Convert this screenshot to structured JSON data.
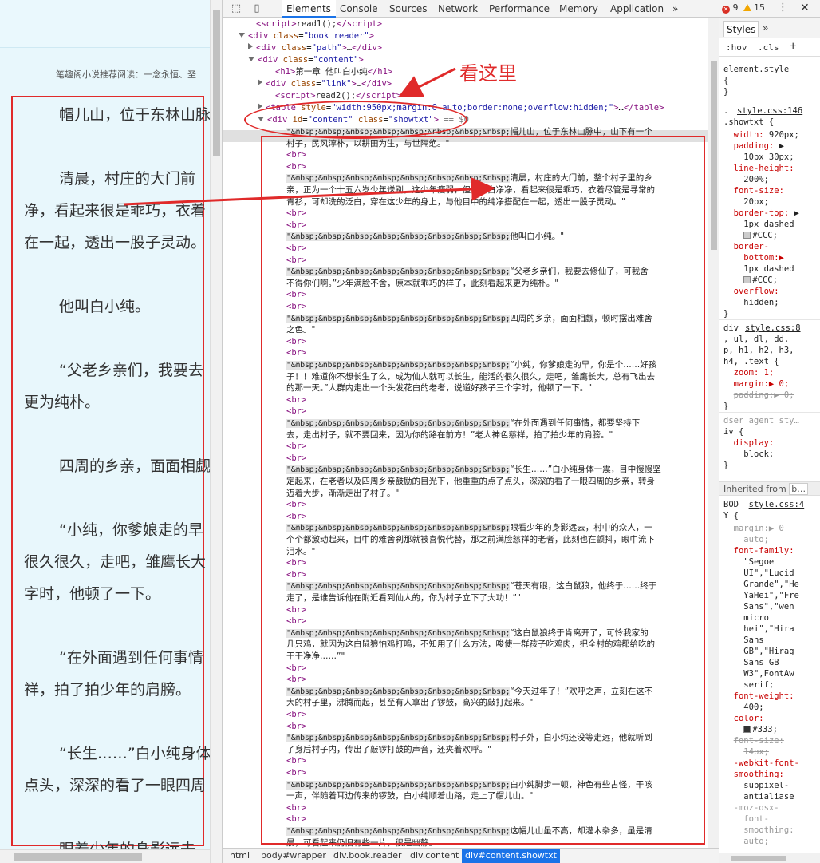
{
  "left_page": {
    "banner": "笔趣阁小说推荐阅读：一念永恒、圣",
    "paragraphs": [
      [
        "帽儿山，位于东林山脉"
      ],
      [
        "清晨，村庄的大门前",
        "净，看起来很是乖巧，衣着",
        "在一起，透出一股子灵动。"
      ],
      [
        "他叫白小纯。"
      ],
      [
        "“父老乡亲们，我要去",
        "更为纯朴。"
      ],
      [
        "四周的乡亲，面面相觑"
      ],
      [
        "“小纯，你爹娘走的早",
        "很久很久，走吧，雏鹰长大",
        "字时，他顿了一下。"
      ],
      [
        "“在外面遇到任何事情",
        "祥，拍了拍少年的肩膀。"
      ],
      [
        "“长生……”白小纯身体一",
        "点头，深深的看了一眼四周"
      ],
      [
        "眼着少年的身影远去"
      ]
    ]
  },
  "devtools": {
    "tabs": [
      "Elements",
      "Console",
      "Sources",
      "Network",
      "Performance",
      "Memory",
      "Application"
    ],
    "more_tabs": "»",
    "errors": "9",
    "warnings": "15",
    "annotation": "看这里",
    "dom_lines": [
      {
        "indent": 42,
        "tri": "",
        "html": "<span class='tg'>&lt;script&gt;</span><span class='tx'>read1();</span><span class='tg'>&lt;/script&gt;</span>"
      },
      {
        "indent": 30,
        "tri": "d",
        "html": "<span class='tg'>&lt;div</span> <span class='an'>class</span>=<span class='av'>\"book reader\"</span><span class='tg'>&gt;</span>"
      },
      {
        "indent": 42,
        "tri": "r",
        "html": "<span class='tg'>&lt;div</span> <span class='an'>class</span>=<span class='av'>\"path\"</span><span class='tg'>&gt;</span>…<span class='tg'>&lt;/div&gt;</span>"
      },
      {
        "indent": 42,
        "tri": "d",
        "html": "<span class='tg'>&lt;div</span> <span class='an'>class</span>=<span class='av'>\"content\"</span><span class='tg'>&gt;</span>"
      },
      {
        "indent": 66,
        "tri": "",
        "html": "<span class='tg'>&lt;h1&gt;</span><span class='tx'>第一章 他叫白小纯</span><span class='tg'>&lt;/h1&gt;</span>"
      },
      {
        "indent": 54,
        "tri": "r",
        "html": "<span class='tg'>&lt;div</span> <span class='an'>class</span>=<span class='av'>\"link\"</span><span class='tg'>&gt;</span>…<span class='tg'>&lt;/div&gt;</span>"
      },
      {
        "indent": 66,
        "tri": "",
        "html": "<span class='tg'>&lt;script&gt;</span><span class='tx'>read2();</span><span class='tg'>&lt;/script&gt;</span>"
      },
      {
        "indent": 54,
        "tri": "r",
        "html": "<span class='tg'>&lt;table</span> <span class='an'>style</span>=<span class='av'>\"width:950px;margin:0 auto;border:none;overflow:hidden;\"</span><span class='tg'>&gt;</span>…<span class='tg'>&lt;/table&gt;</span>"
      },
      {
        "indent": 54,
        "tri": "d",
        "html": "<span class='tg'>&lt;div</span> <span class='an'>id</span>=<span class='av'>\"content\"</span> <span class='an'>class</span>=<span class='av'>\"showtxt\"</span><span class='tg'>&gt;</span> <span class='cm'>== $0</span>"
      }
    ],
    "nbsp_prefix": "\"&nbsp;&nbsp;&nbsp;&nbsp;&nbsp;&nbsp;&nbsp;&nbsp;",
    "br_tag": "<br>",
    "content_blocks": [
      {
        "lines": [
          "帽儿山，位于东林山脉中，山下有一个",
          "村子，民风淳朴，以耕田为生，与世隔绝。\""
        ]
      },
      {
        "lines": [
          "清晨，村庄的大门前，整个村子里的乡",
          "亲，正为一个十五六岁少年送别，这少年瘦弱，但却白白净净，看起来很是乖巧，衣着尽管是寻常的",
          "青衫，可却洗的泛白，穿在这少年的身上，与他目中的纯净搭配在一起，透出一股子灵动。\""
        ]
      },
      {
        "lines": [
          "他叫白小纯。\""
        ]
      },
      {
        "lines": [
          "“父老乡亲们，我要去修仙了，可我舍",
          "不得你们啊。”少年满脸不舍，原本就乖巧的样子，此刻看起来更为纯朴。\""
        ]
      },
      {
        "lines": [
          "四周的乡亲，面面相觑，顿时摆出难舍",
          "之色。\""
        ]
      },
      {
        "lines": [
          "“小纯，你爹娘走的早，你是个……好孩",
          "子！！难道你不想长生了么，成为仙人就可以长生，能活的很久很久，走吧，雏鹰长大，总有飞出去",
          "的那一天。”人群内走出一个头发花白的老者，说道好孩子三个字时，他顿了一下。\""
        ]
      },
      {
        "lines": [
          "“在外面遇到任何事情，都要坚持下",
          "去，走出村子，就不要回来，因为你的路在前方！”老人神色慈祥，拍了拍少年的肩膀。\""
        ]
      },
      {
        "lines": [
          "“长生……”白小纯身体一震，目中慢慢坚",
          "定起来，在老者以及四周乡亲鼓励的目光下，他重重的点了点头，深深的看了一眼四周的乡亲，转身",
          "迈着大步，渐渐走出了村子。\""
        ]
      },
      {
        "lines": [
          "眼看少年的身影远去，村中的众人，一",
          "个个都激动起来，目中的难舍刹那就被喜悦代替，那之前满脸慈祥的老者，此刻也在颤抖，眼中流下",
          "泪水。\""
        ]
      },
      {
        "lines": [
          "“苍天有眼，这白鼠狼，他终于……终于",
          "走了，是谁告诉他在附近看到仙人的，你为村子立下了大功！”\""
        ]
      },
      {
        "lines": [
          "“这白鼠狼终于肯离开了，可怜我家的",
          "几只鸡，就因为这白鼠狼怕鸡打鸣，不知用了什么方法，唆使一群孩子吃鸡肉，把全村的鸡都给吃的",
          "干干净净……”\""
        ]
      },
      {
        "lines": [
          "“今天过年了！”欢呼之声，立刻在这不",
          "大的村子里，沸腾而起，甚至有人拿出了锣鼓，高兴的敲打起来。\""
        ]
      },
      {
        "lines": [
          "村子外，白小纯还没等走远，他就听到",
          "了身后村子内，传出了敲锣打鼓的声音，还夹着欢呼。\""
        ]
      },
      {
        "lines": [
          "白小纯脚步一顿，神色有些古怪，干咳",
          "一声，伴随着耳边传来的锣鼓，白小纯顺着山路，走上了帽儿山。\""
        ]
      },
      {
        "lines": [
          "这帽儿山虽不高，却灌木杂多，虽是清",
          "晨，可看起来仍旧有些一片，很是幽静。"
        ]
      }
    ],
    "breadcrumbs": [
      "html",
      "body#wrapper",
      "div.book.reader",
      "div.content",
      "div#content.showtxt"
    ]
  },
  "styles_pane": {
    "tab": "Styles",
    "more": "»",
    "hov": ":hov",
    "cls": ".cls",
    "plus": "+",
    "element_style": "element.style",
    "brace_open": "{",
    "brace_close": "}",
    "rule1_link": "style.css:146",
    "rule1_sel": ".showtxt {",
    "rule1_props": [
      {
        "name": "width",
        "val": "920px;"
      },
      {
        "name": "padding",
        "val": "▶",
        "sub": "10px 30px;"
      },
      {
        "name": "line-height",
        "val": "",
        "sub": "200%;"
      },
      {
        "name": "font-size",
        "val": "",
        "sub": "20px;"
      },
      {
        "name": "border-top",
        "val": "▶",
        "sub": "1px dashed",
        "sub2": "#CCC;"
      },
      {
        "name": "border-",
        "val": "",
        "sub": "bottom:▶",
        "sub2": "1px dashed",
        "sub3": "#CCC;"
      },
      {
        "name": "overflow",
        "val": "",
        "sub": "hidden;"
      }
    ],
    "rule2_sel": "div",
    "rule2_link": "style.css:8",
    "rule2_sel2": ", ul, dl, dd,",
    "rule2_sel3": "p, h1, h2, h3,",
    "rule2_sel4": "h4, .text {",
    "rule2_zoom": "zoom: 1;",
    "rule2_margin": "margin:▶ 0;",
    "rule2_padding": "padding:▶ 0;",
    "ua_sel": "dser agent sty…",
    "ua_sel2": "iv {",
    "ua_prop": "display:",
    "ua_val": "block;",
    "inherited": "Inherited from",
    "inherited_from": "b…",
    "body_sel": "BOD",
    "body_link": "style.css:4",
    "body_sel2": "Y {",
    "body_props": [
      "margin:▶ 0",
      "auto;",
      "font-family:",
      "\"Segoe",
      "UI\",\"Lucid",
      "Grande\",\"He",
      "YaHei\",\"Fre",
      "Sans\",\"wen",
      "micro",
      "hei\",\"Hira",
      "Sans",
      "GB\",\"Hirag",
      "Sans GB",
      "W3\",FontAw",
      "serif;",
      "font-weight:",
      "400;",
      "color:",
      "#333;",
      "font-size:",
      "14px;",
      "-webkit-font-",
      "smoothing:",
      "subpixel-",
      "antialiase",
      "-moz-osx-",
      "font-",
      "smoothing:",
      "auto;"
    ]
  }
}
